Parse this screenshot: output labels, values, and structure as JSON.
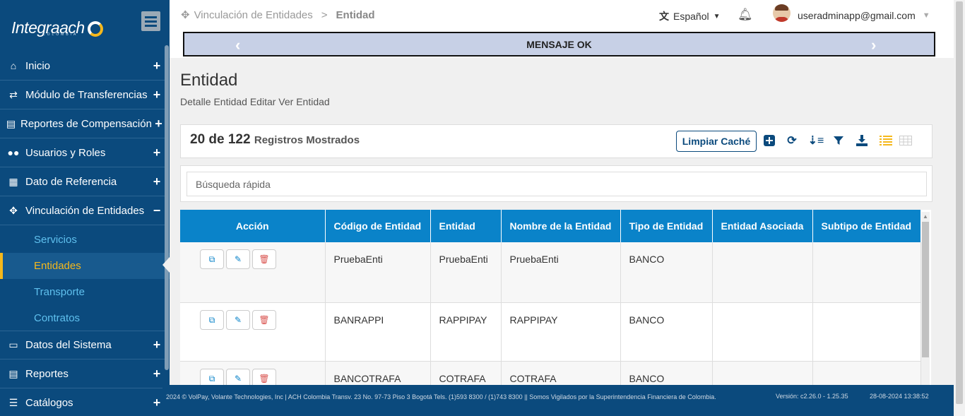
{
  "app": {
    "logo_text": "Integraach",
    "logo_sub": "COLOMBIA"
  },
  "sidebar": {
    "items": [
      {
        "label": "Inicio",
        "icon": "home-icon",
        "toggle": "+"
      },
      {
        "label": "Módulo de Transferencias",
        "icon": "exchange-icon",
        "toggle": "+"
      },
      {
        "label": "Reportes de Compensación",
        "icon": "file-icon",
        "toggle": "+"
      },
      {
        "label": "Usuarios y Roles",
        "icon": "users-icon",
        "toggle": "+"
      },
      {
        "label": "Dato de Referencia",
        "icon": "calendar-icon",
        "toggle": "+"
      },
      {
        "label": "Vinculación de Entidades",
        "icon": "link-icon",
        "toggle": "−"
      },
      {
        "label": "Datos del Sistema",
        "icon": "desktop-icon",
        "toggle": "+"
      },
      {
        "label": "Reportes",
        "icon": "report-icon",
        "toggle": "+"
      },
      {
        "label": "Catálogos",
        "icon": "list-icon",
        "toggle": "+"
      }
    ],
    "subitems": [
      {
        "label": "Servicios"
      },
      {
        "label": "Entidades"
      },
      {
        "label": "Transporte"
      },
      {
        "label": "Contratos"
      }
    ]
  },
  "header": {
    "breadcrumb_parent": "Vinculación de Entidades",
    "breadcrumb_sep": ">",
    "breadcrumb_current": "Entidad",
    "language": "Español",
    "user_email": "useradminapp@gmail.com"
  },
  "banner": {
    "message": "MENSAJE OK"
  },
  "page": {
    "title": "Entidad",
    "subtitle": "Detalle Entidad Editar Ver Entidad"
  },
  "toolbar": {
    "count": "20 de 122",
    "count_label": "Registros Mostrados",
    "cache_button": "Limpiar Caché"
  },
  "search": {
    "placeholder": "Búsqueda rápida"
  },
  "table": {
    "columns": [
      "Acción",
      "Código de Entidad",
      "Entidad",
      "Nombre de la Entidad",
      "Tipo de Entidad",
      "Entidad Asociada",
      "Subtipo de Entidad"
    ],
    "rows": [
      {
        "codigo": "PruebaEnti",
        "entidad": "PruebaEnti",
        "nombre": "PruebaEnti",
        "tipo": "BANCO",
        "asociada": "",
        "subtipo": ""
      },
      {
        "codigo": "BANRAPPI",
        "entidad": "RAPPIPAY",
        "nombre": "RAPPIPAY",
        "tipo": "BANCO",
        "asociada": "",
        "subtipo": ""
      },
      {
        "codigo": "BANCOTRAFA",
        "entidad": "COTRAFA",
        "nombre": "COTRAFA",
        "tipo": "BANCO",
        "asociada": "",
        "subtipo": ""
      }
    ]
  },
  "footer": {
    "text": "2024 © VolPay, Volante Technologies, Inc | ACH Colombia Transv. 23 No. 97-73 Piso 3 Bogotá Tels. (1)593 8300 / (1)743 8300 || Somos Vigilados por la Superintendencia Financiera de Colombia.",
    "version": "Versión: c2.26.0 - 1.25.35",
    "datetime": "28-08-2024 13:38:52"
  },
  "colors": {
    "sidebar": "#0b4a7d",
    "accent": "#f5b81c",
    "table_header": "#0a83c9",
    "banner": "#c7d0e6"
  }
}
